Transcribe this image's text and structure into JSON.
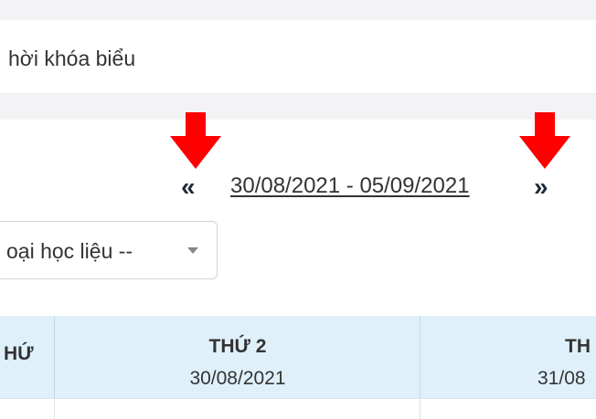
{
  "header": {
    "title": "hời khóa biểu"
  },
  "week_nav": {
    "prev_label": "«",
    "range": "30/08/2021 - 05/09/2021",
    "next_label": "»"
  },
  "filter": {
    "selected": "oại học liệu --"
  },
  "schedule": {
    "columns": [
      {
        "day": "HỨ",
        "date": ""
      },
      {
        "day": "THỨ 2",
        "date": "30/08/2021"
      },
      {
        "day": "TH",
        "date": "31/08"
      }
    ]
  },
  "colors": {
    "annotation_arrow": "#ff0000",
    "table_header_bg": "#dff0fb",
    "band_bg": "#f3f3f5"
  }
}
